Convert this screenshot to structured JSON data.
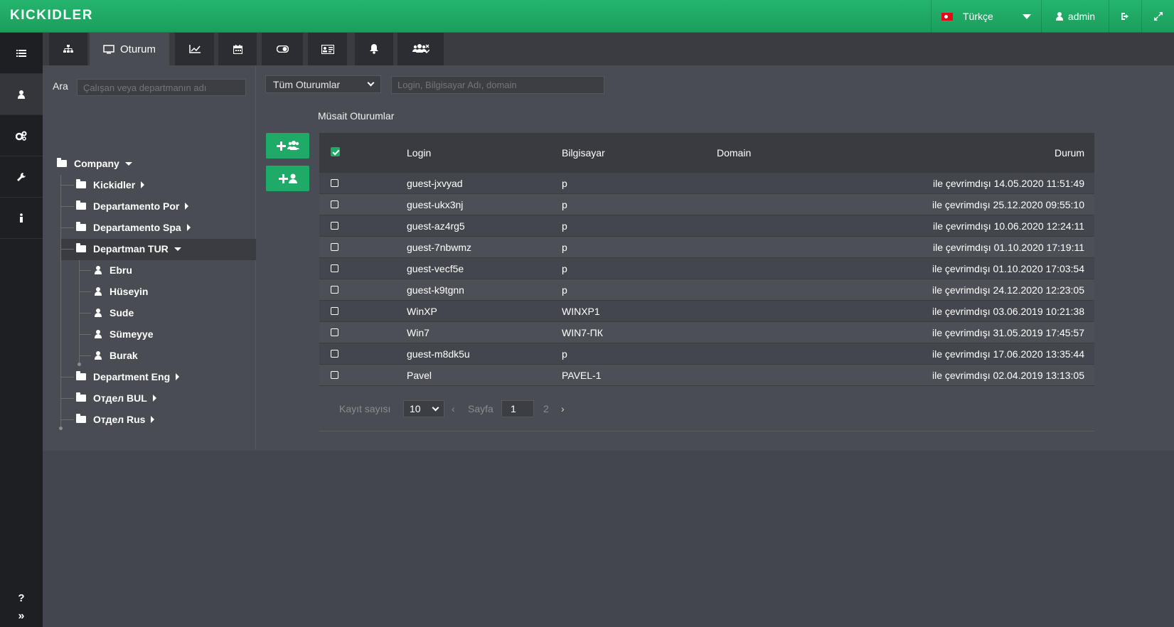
{
  "app": {
    "logo": "KICKIDLER"
  },
  "topbar": {
    "language": "Türkçe",
    "user": "admin"
  },
  "search": {
    "label": "Ara",
    "placeholder": "Çalışan veya departmanın adı"
  },
  "tabs": {
    "session_label": "Oturum"
  },
  "tree": {
    "root": "Company",
    "items": [
      {
        "label": "Kickidler"
      },
      {
        "label": "Departamento Por"
      },
      {
        "label": "Departamento Spa"
      },
      {
        "label": "Departman TUR"
      },
      {
        "label": "Ebru"
      },
      {
        "label": "Hüseyin"
      },
      {
        "label": "Sude"
      },
      {
        "label": "Sümeyye"
      },
      {
        "label": "Burak"
      },
      {
        "label": "Department Eng"
      },
      {
        "label": "Отдел BUL"
      },
      {
        "label": "Отдел Rus"
      }
    ]
  },
  "filter": {
    "selected": "Tüm Oturumlar",
    "placeholder": "Login, Bilgisayar Adı, domain"
  },
  "sessions": {
    "title": "Müsait Oturumlar",
    "columns": {
      "login": "Login",
      "computer": "Bilgisayar",
      "domain": "Domain",
      "status": "Durum"
    },
    "rows": [
      {
        "login": "guest-jxvyad",
        "computer": "p",
        "domain": "",
        "status": "ile çevrimdışı 14.05.2020 11:51:49"
      },
      {
        "login": "guest-ukx3nj",
        "computer": "p",
        "domain": "",
        "status": "ile çevrimdışı 25.12.2020 09:55:10"
      },
      {
        "login": "guest-az4rg5",
        "computer": "p",
        "domain": "",
        "status": "ile çevrimdışı 10.06.2020 12:24:11"
      },
      {
        "login": "guest-7nbwmz",
        "computer": "p",
        "domain": "",
        "status": "ile çevrimdışı 01.10.2020 17:19:11"
      },
      {
        "login": "guest-vecf5e",
        "computer": "p",
        "domain": "",
        "status": "ile çevrimdışı 01.10.2020 17:03:54"
      },
      {
        "login": "guest-k9tgnn",
        "computer": "p",
        "domain": "",
        "status": "ile çevrimdışı 24.12.2020 12:23:05"
      },
      {
        "login": "WinXP",
        "computer": "WINXP1",
        "domain": "",
        "status": "ile çevrimdışı 03.06.2019 10:21:38"
      },
      {
        "login": "Win7",
        "computer": "WIN7-ПК",
        "domain": "",
        "status": "ile çevrimdışı 31.05.2019 17:45:57"
      },
      {
        "login": "guest-m8dk5u",
        "computer": "p",
        "domain": "",
        "status": "ile çevrimdışı 17.06.2020 13:35:44"
      },
      {
        "login": "Pavel",
        "computer": "PAVEL-1",
        "domain": "",
        "status": "ile çevrimdışı 02.04.2019 13:13:05"
      }
    ]
  },
  "pagination": {
    "records_label": "Kayıt sayısı",
    "records_value": "10",
    "prev": "‹",
    "page_label": "Sayfa",
    "page_value": "1",
    "page_next_number": "2",
    "next": "›"
  },
  "rail": {
    "help": "?",
    "expand": "»"
  },
  "colors": {
    "accent": "#1fab67",
    "sidebar": "#1d1f23",
    "background": "#4a4c54"
  }
}
